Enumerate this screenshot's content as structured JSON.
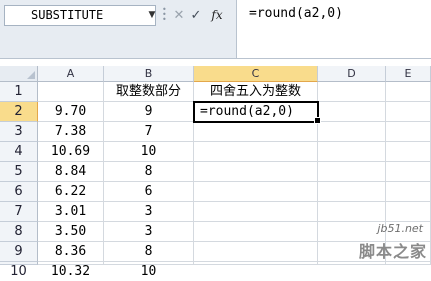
{
  "formula_bar": {
    "name_box": "SUBSTITUTE",
    "dropdown_icon": "chevron-down-icon",
    "cancel_glyph": "✕",
    "enter_glyph": "✓",
    "insert_function_label": "fx",
    "formula": "=round(a2,0)"
  },
  "sheet": {
    "columns": [
      "A",
      "B",
      "C",
      "D",
      "E"
    ],
    "active_column": "C",
    "active_row": "2",
    "rows": [
      {
        "num": "1",
        "a": "",
        "b": "取整数部分",
        "c": "四舍五入为整数"
      },
      {
        "num": "2",
        "a": "9.70",
        "b": "9",
        "c": "=round(a2,0)"
      },
      {
        "num": "3",
        "a": "7.38",
        "b": "7",
        "c": ""
      },
      {
        "num": "4",
        "a": "10.69",
        "b": "10",
        "c": ""
      },
      {
        "num": "5",
        "a": "8.84",
        "b": "8",
        "c": ""
      },
      {
        "num": "6",
        "a": "6.22",
        "b": "6",
        "c": ""
      },
      {
        "num": "7",
        "a": "3.01",
        "b": "3",
        "c": ""
      },
      {
        "num": "8",
        "a": "3.50",
        "b": "3",
        "c": ""
      },
      {
        "num": "9",
        "a": "8.36",
        "b": "8",
        "c": ""
      },
      {
        "num": "10",
        "a": "10.32",
        "b": "10",
        "c": ""
      }
    ]
  },
  "watermark": {
    "top": "jb51.net",
    "bottom": "脚本之家"
  }
}
